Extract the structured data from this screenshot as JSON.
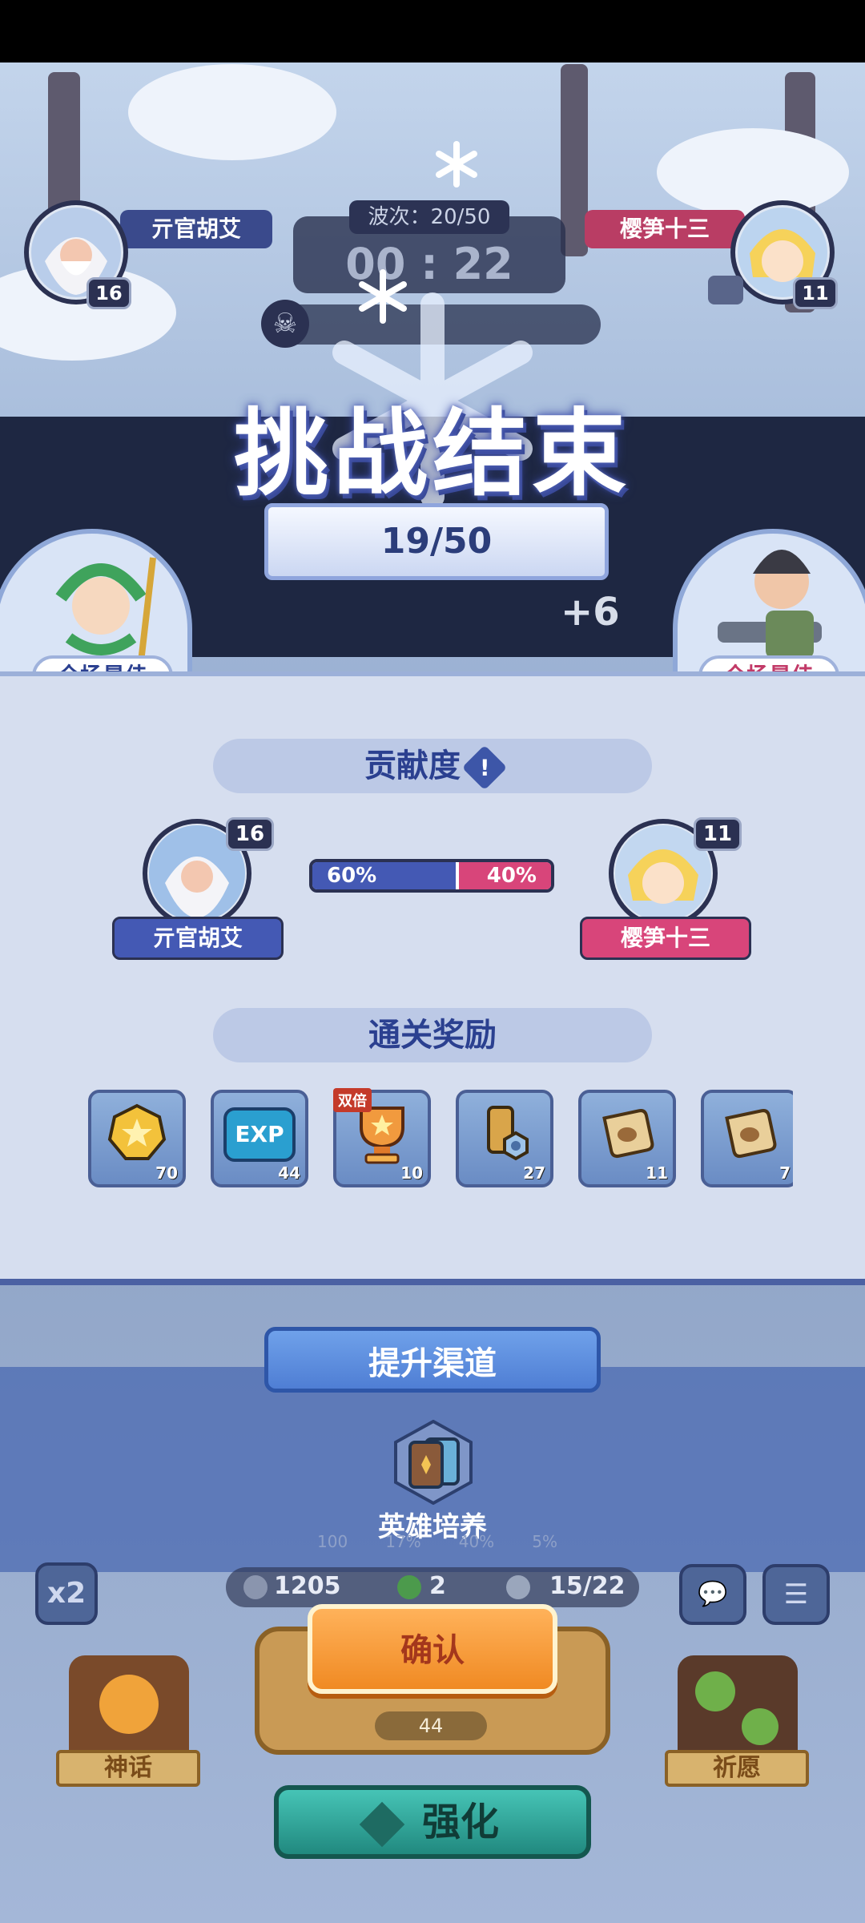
{
  "hud": {
    "player_left": {
      "name": "亓官胡艾",
      "level": "16"
    },
    "player_right": {
      "name": "樱笋十三",
      "level": "11"
    },
    "wave_label": "波次：20/50",
    "timer": "00 : 22"
  },
  "result": {
    "title": "挑战结束",
    "score": "19/50",
    "bonus": "+6",
    "mvp_left": "全场最佳",
    "mvp_right": "全场最佳"
  },
  "contribution": {
    "title": "贡献度",
    "info_symbol": "!",
    "left_player": {
      "name": "亓官胡艾",
      "level": "16",
      "percent_label": "60%",
      "percent": 60
    },
    "right_player": {
      "name": "樱笋十三",
      "level": "11",
      "percent_label": "40%",
      "percent": 40
    }
  },
  "rewards": {
    "title": "通关奖励",
    "items": [
      {
        "icon": "coin-icon",
        "count": "70",
        "tag": ""
      },
      {
        "icon": "exp-icon",
        "count": "44",
        "tag": ""
      },
      {
        "icon": "trophy-icon",
        "count": "10",
        "tag": "双倍"
      },
      {
        "icon": "bolt-nut-icon",
        "count": "27",
        "tag": ""
      },
      {
        "icon": "scroll-icon",
        "count": "11",
        "tag": ""
      },
      {
        "icon": "scroll-icon",
        "count": "7",
        "tag": ""
      }
    ],
    "exp_text": "EXP"
  },
  "improve": {
    "title": "提升渠道",
    "item_label": "英雄培养"
  },
  "bottom": {
    "x2_label": "x2",
    "silver": "1205",
    "clover": "2",
    "unit_capacity": "15/22",
    "confirm_label": "确认",
    "upgrade_cost": "44",
    "strengthen_label": "强化",
    "myth_label": "神话",
    "wish_label": "祈愿",
    "bg_percents": [
      "100",
      "17%",
      "40%",
      "5%"
    ]
  },
  "colors": {
    "accent_blue": "#4459b4",
    "accent_pink": "#d8457a",
    "confirm_orange": "#f08a23",
    "strengthen_teal": "#21897f"
  }
}
